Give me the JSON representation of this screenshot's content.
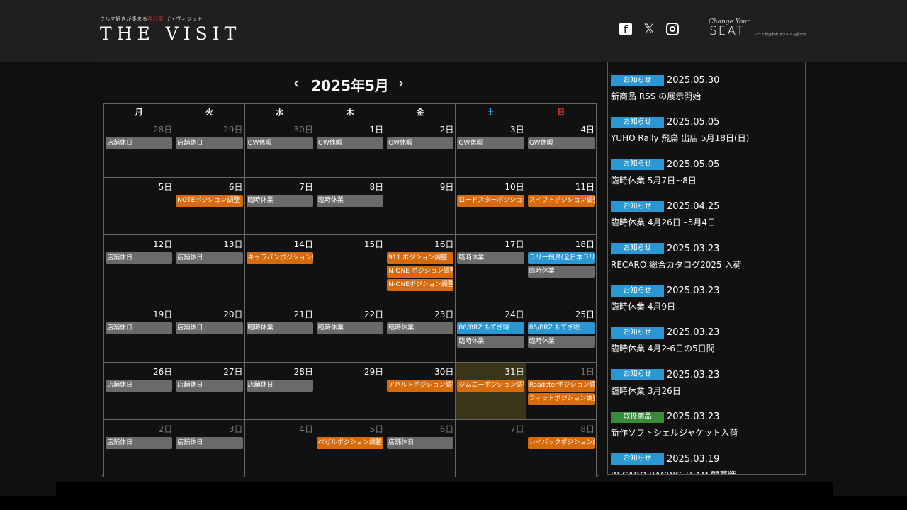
{
  "header": {
    "tagline_pre": "クルマ好きが集まる",
    "tagline_red": "隠れ家",
    "tagline_post": "ザ・ヴィジット",
    "brand": "THE VISIT",
    "social": {
      "fb": "f",
      "x": "𝕏"
    },
    "seat_script": "Change Your",
    "seat": "SEAT",
    "seat_sub": "シートが変わればクルマも変わる"
  },
  "calendar": {
    "prev": "‹",
    "next": "›",
    "title": "2025年5月",
    "weekdays": [
      "月",
      "火",
      "水",
      "木",
      "金",
      "土",
      "日"
    ],
    "weeks": [
      [
        {
          "day": "28日",
          "other": true,
          "events": [
            {
              "label": "店舗休日",
              "color": "gray"
            }
          ]
        },
        {
          "day": "29日",
          "other": true,
          "events": [
            {
              "label": "店舗休日",
              "color": "gray"
            }
          ]
        },
        {
          "day": "30日",
          "other": true,
          "events": [
            {
              "label": "GW休暇",
              "color": "gray"
            }
          ]
        },
        {
          "day": "1日",
          "events": [
            {
              "label": "GW休暇",
              "color": "gray"
            }
          ]
        },
        {
          "day": "2日",
          "events": [
            {
              "label": "GW休暇",
              "color": "gray"
            }
          ]
        },
        {
          "day": "3日",
          "events": [
            {
              "label": "GW休暇",
              "color": "gray"
            }
          ]
        },
        {
          "day": "4日",
          "events": [
            {
              "label": "GW休暇",
              "color": "gray"
            }
          ]
        }
      ],
      [
        {
          "day": "5日",
          "events": []
        },
        {
          "day": "6日",
          "events": [
            {
              "label": "NOTEポジション調整",
              "color": "orange"
            }
          ]
        },
        {
          "day": "7日",
          "events": [
            {
              "label": "臨時休業",
              "color": "gray"
            }
          ]
        },
        {
          "day": "8日",
          "events": [
            {
              "label": "臨時休業",
              "color": "gray"
            }
          ]
        },
        {
          "day": "9日",
          "events": []
        },
        {
          "day": "10日",
          "events": [
            {
              "label": "ロードスターポジション調整",
              "color": "orange"
            }
          ]
        },
        {
          "day": "11日",
          "events": [
            {
              "label": "スイフトポジション調整",
              "color": "orange"
            }
          ]
        }
      ],
      [
        {
          "day": "12日",
          "events": [
            {
              "label": "店舗休日",
              "color": "gray"
            }
          ]
        },
        {
          "day": "13日",
          "events": [
            {
              "label": "店舗休日",
              "color": "gray"
            }
          ]
        },
        {
          "day": "14日",
          "events": [
            {
              "label": "キャラバンポジション調整",
              "color": "orange"
            }
          ]
        },
        {
          "day": "15日",
          "events": []
        },
        {
          "day": "16日",
          "events": [
            {
              "label": "911 ポジション調整",
              "color": "orange"
            },
            {
              "label": "N-ONE ポジション調整",
              "color": "orange"
            },
            {
              "label": "N-ONEポジション調整",
              "color": "orange"
            }
          ]
        },
        {
          "day": "17日",
          "events": [
            {
              "label": "臨時休業",
              "color": "gray"
            }
          ]
        },
        {
          "day": "18日",
          "events": [
            {
              "label": "ラリー飛鳥(全日本ラリー",
              "color": "blue"
            },
            {
              "label": "臨時休業",
              "color": "gray"
            }
          ]
        }
      ],
      [
        {
          "day": "19日",
          "events": [
            {
              "label": "店舗休日",
              "color": "gray"
            }
          ]
        },
        {
          "day": "20日",
          "events": [
            {
              "label": "店舗休日",
              "color": "gray"
            }
          ]
        },
        {
          "day": "21日",
          "events": [
            {
              "label": "臨時休業",
              "color": "gray"
            }
          ]
        },
        {
          "day": "22日",
          "events": [
            {
              "label": "臨時休業",
              "color": "gray"
            }
          ]
        },
        {
          "day": "23日",
          "events": [
            {
              "label": "臨時休業",
              "color": "gray"
            }
          ]
        },
        {
          "day": "24日",
          "events": [
            {
              "label": "86/BRZ もてぎ戦",
              "color": "blue"
            },
            {
              "label": "臨時休業",
              "color": "gray"
            }
          ]
        },
        {
          "day": "25日",
          "events": [
            {
              "label": "86/BRZ もてぎ戦",
              "color": "blue"
            },
            {
              "label": "臨時休業",
              "color": "gray"
            }
          ]
        }
      ],
      [
        {
          "day": "26日",
          "events": [
            {
              "label": "店舗休日",
              "color": "gray"
            }
          ]
        },
        {
          "day": "27日",
          "events": [
            {
              "label": "店舗休日",
              "color": "gray"
            }
          ]
        },
        {
          "day": "28日",
          "events": [
            {
              "label": "店舗休日",
              "color": "gray"
            }
          ]
        },
        {
          "day": "29日",
          "events": []
        },
        {
          "day": "30日",
          "events": [
            {
              "label": "アバルトポジション調整",
              "color": "orange"
            }
          ]
        },
        {
          "day": "31日",
          "today": true,
          "events": [
            {
              "label": "ジムニーポジション調整",
              "color": "orange"
            }
          ]
        },
        {
          "day": "1日",
          "other": true,
          "events": [
            {
              "label": "Roadsterポジション調整",
              "color": "orange"
            },
            {
              "label": "フィットポジション調整",
              "color": "orange"
            }
          ]
        }
      ],
      [
        {
          "day": "2日",
          "other": true,
          "events": [
            {
              "label": "店舗休日",
              "color": "gray"
            }
          ]
        },
        {
          "day": "3日",
          "other": true,
          "events": [
            {
              "label": "店舗休日",
              "color": "gray"
            }
          ]
        },
        {
          "day": "4日",
          "other": true,
          "events": []
        },
        {
          "day": "5日",
          "other": true,
          "events": [
            {
              "label": "ベゼルポジション調整",
              "color": "orange"
            }
          ]
        },
        {
          "day": "6日",
          "other": true,
          "events": [
            {
              "label": "店舗休日",
              "color": "gray"
            }
          ]
        },
        {
          "day": "7日",
          "other": true,
          "events": []
        },
        {
          "day": "8日",
          "other": true,
          "events": [
            {
              "label": "レイバックポジション調整",
              "color": "orange"
            }
          ]
        }
      ]
    ]
  },
  "news": [
    {
      "badge": "お知らせ",
      "type": "blue",
      "date": "2025.05.30",
      "title": "新商品 RSS の展示開始"
    },
    {
      "badge": "お知らせ",
      "type": "blue",
      "date": "2025.05.05",
      "title": "YUHO Rally 飛鳥 出店 5月18日(日)"
    },
    {
      "badge": "お知らせ",
      "type": "blue",
      "date": "2025.05.05",
      "title": "臨時休業 5月7日~8日"
    },
    {
      "badge": "お知らせ",
      "type": "blue",
      "date": "2025.04.25",
      "title": "臨時休業 4月26日~5月4日"
    },
    {
      "badge": "お知らせ",
      "type": "blue",
      "date": "2025.03.23",
      "title": "RECARO 総合カタログ2025 入荷"
    },
    {
      "badge": "お知らせ",
      "type": "blue",
      "date": "2025.03.23",
      "title": "臨時休業 4月9日"
    },
    {
      "badge": "お知らせ",
      "type": "blue",
      "date": "2025.03.23",
      "title": "臨時休業 4月2-6日の5日間"
    },
    {
      "badge": "お知らせ",
      "type": "blue",
      "date": "2025.03.23",
      "title": "臨時休業 3月26日"
    },
    {
      "badge": "取扱商品",
      "type": "green",
      "date": "2025.03.23",
      "title": "新作ソフトシェルジャケット入荷"
    },
    {
      "badge": "お知らせ",
      "type": "blue",
      "date": "2025.03.19",
      "title": "RECARO RACING TEAM 開幕戦"
    }
  ]
}
